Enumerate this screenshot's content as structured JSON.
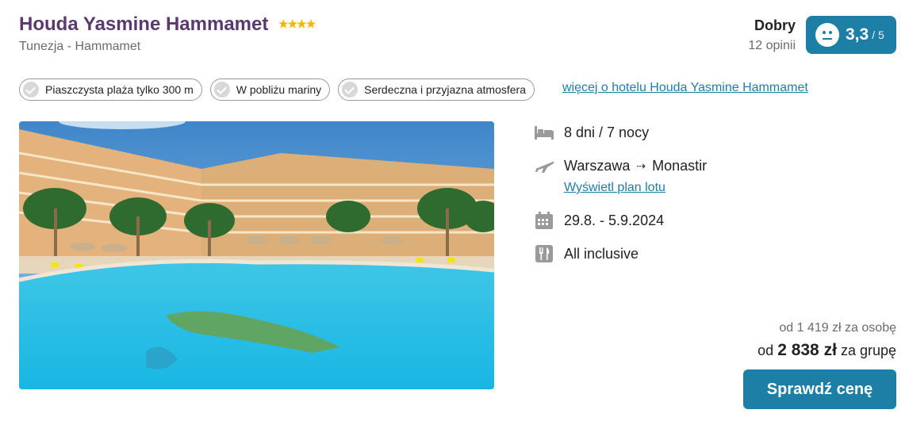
{
  "hotel": {
    "name": "Houda Yasmine Hammamet",
    "stars": 4,
    "location": "Tunezja - Hammamet"
  },
  "rating": {
    "label": "Dobry",
    "opinions": "12 opinii",
    "score": "3,3",
    "max": "/ 5"
  },
  "features": [
    "Piaszczysta plaża tylko 300 m",
    "W pobliżu mariny",
    "Serdeczna i przyjazna atmosfera"
  ],
  "more_link": "więcej o hotelu Houda Yasmine Hammamet",
  "trip": {
    "duration": "8 dni / 7 nocy",
    "from": "Warszawa",
    "to": "Monastir",
    "flight_plan_link": "Wyświetl plan lotu",
    "dates": "29.8. - 5.9.2024",
    "board": "All inclusive"
  },
  "price": {
    "per_person": "od 1 419 zł za osobę",
    "group_prefix": "od",
    "group_amount": "2 838 zł",
    "group_suffix": "za grupę"
  },
  "cta": "Sprawdź cenę",
  "colors": {
    "title": "#5a3a6e",
    "accent": "#1e7fa6",
    "star": "#f5b400"
  }
}
